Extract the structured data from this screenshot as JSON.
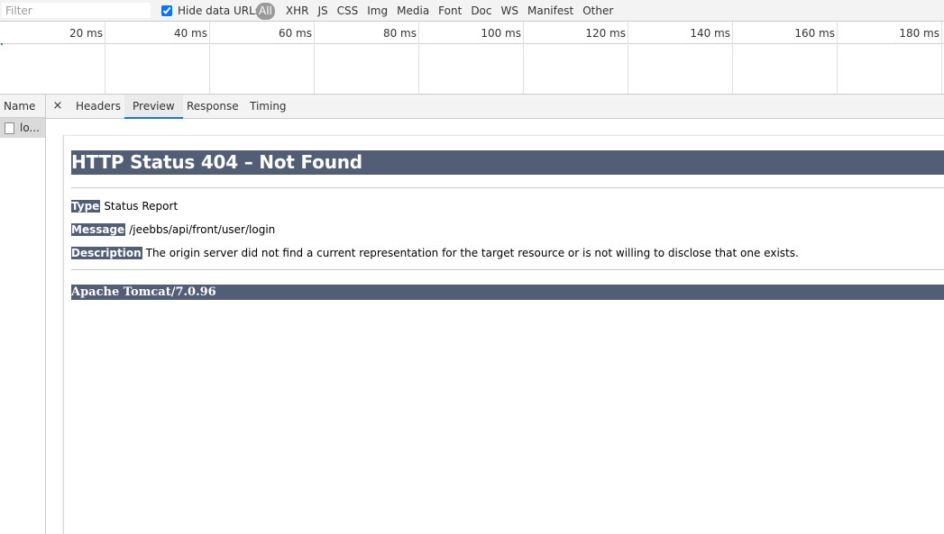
{
  "toolbar": {
    "filter_placeholder": "Filter",
    "hide_data_urls_label": "Hide data URLs",
    "hide_data_urls_checked": true,
    "type_filters": [
      "All",
      "XHR",
      "JS",
      "CSS",
      "Img",
      "Media",
      "Font",
      "Doc",
      "WS",
      "Manifest",
      "Other"
    ],
    "active_filter": "All"
  },
  "timeline": {
    "ticks": [
      "20 ms",
      "40 ms",
      "60 ms",
      "80 ms",
      "100 ms",
      "120 ms",
      "140 ms",
      "160 ms",
      "180 ms"
    ]
  },
  "requests": {
    "column_header": "Name",
    "rows": [
      {
        "name": "lo..."
      }
    ]
  },
  "details": {
    "close_glyph": "×",
    "tabs": [
      "Headers",
      "Preview",
      "Response",
      "Timing"
    ],
    "selected_tab": "Preview"
  },
  "preview": {
    "heading": "HTTP Status 404 – Not Found",
    "type_label": "Type",
    "type_value": "Status Report",
    "message_label": "Message",
    "message_value": "/jeebbs/api/front/user/login",
    "description_label": "Description",
    "description_value": "The origin server did not find a current representation for the target resource or is not willing to disclose that one exists.",
    "footer": "Apache Tomcat/7.0.96"
  },
  "colors": {
    "tomcat_header": "#525d76",
    "selected_tab_underline": "#1a73e8",
    "active_filter_pill": "#9a9a9a"
  }
}
